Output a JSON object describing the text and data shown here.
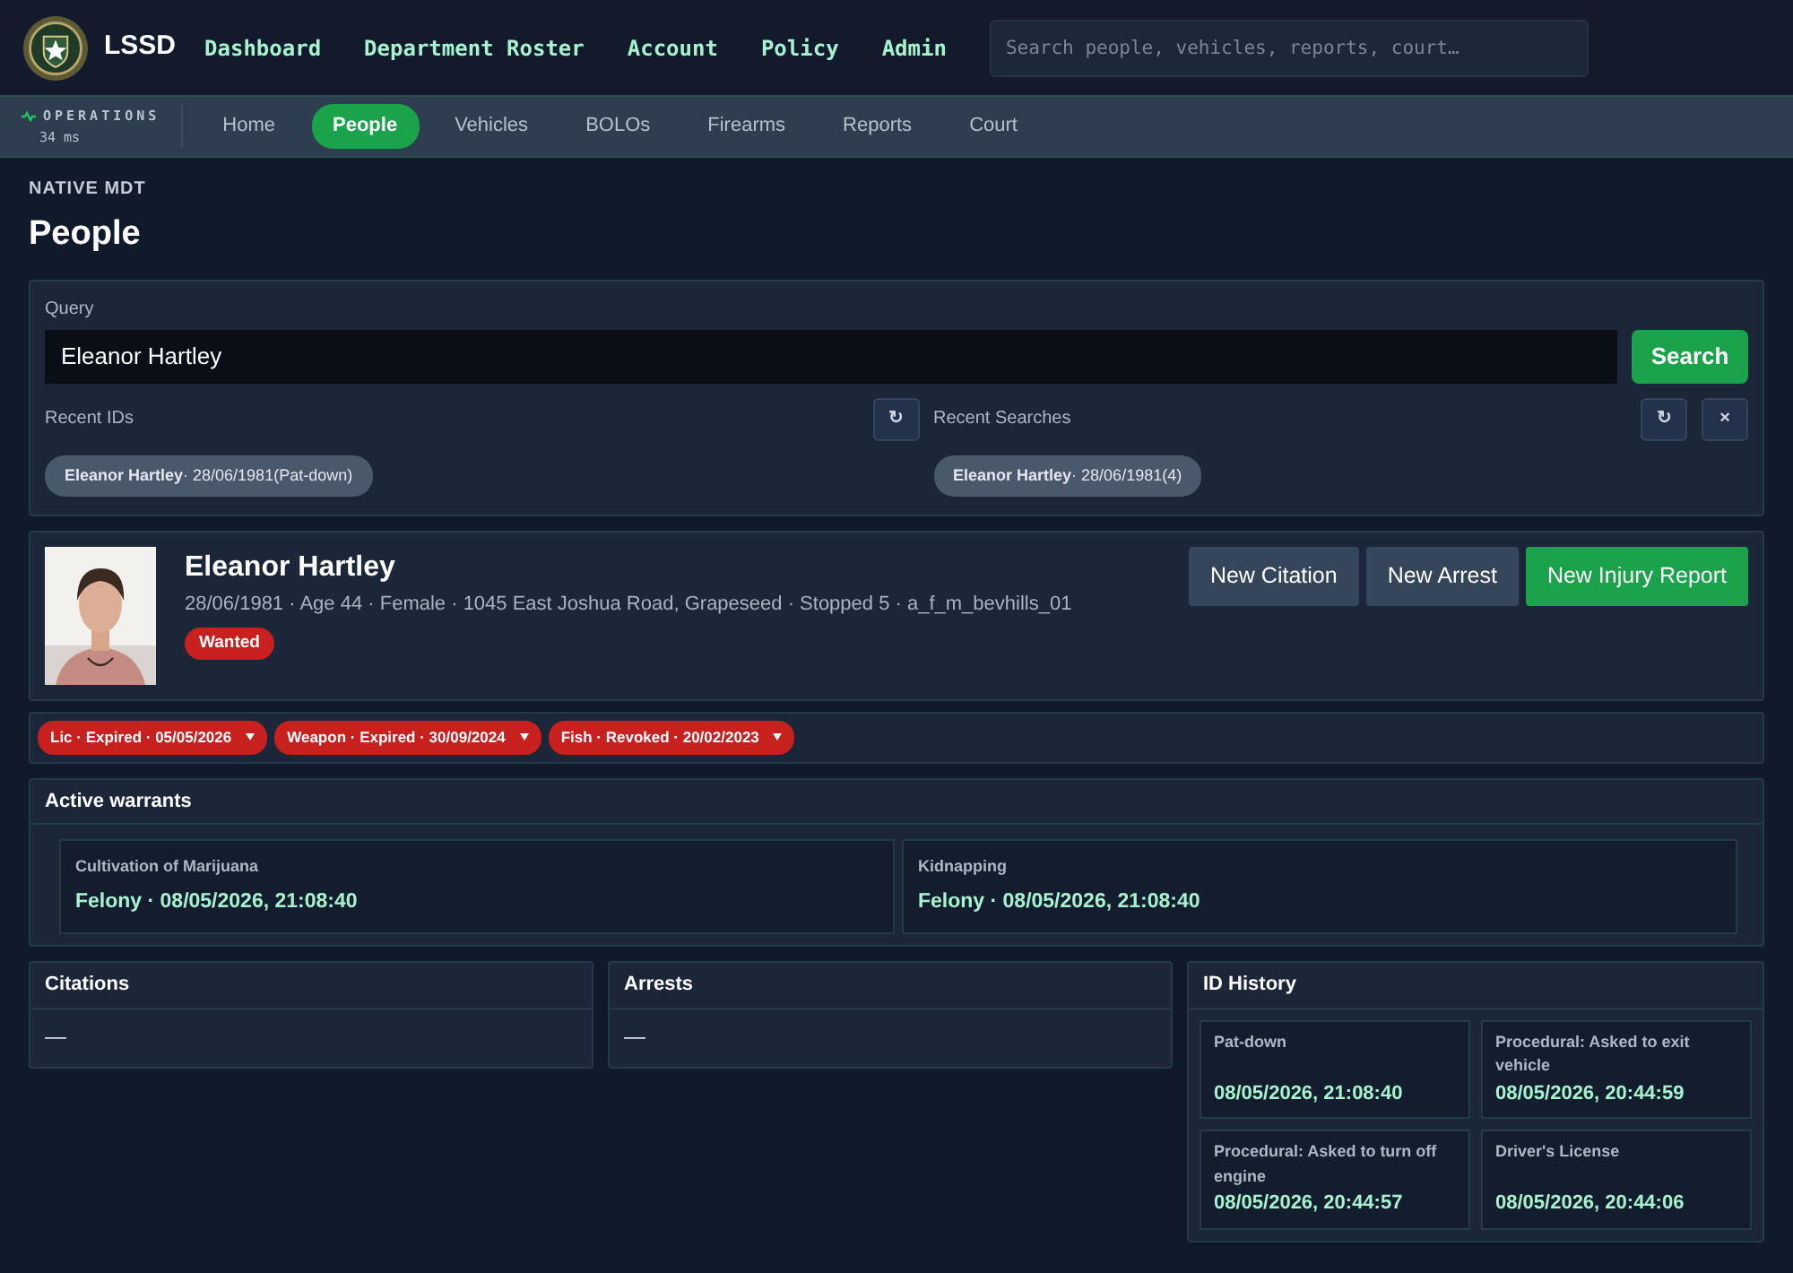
{
  "brand": {
    "name": "LSSD"
  },
  "top_nav": [
    {
      "label": "Dashboard"
    },
    {
      "label": "Department Roster"
    },
    {
      "label": "Account"
    },
    {
      "label": "Policy"
    },
    {
      "label": "Admin"
    }
  ],
  "global_search": {
    "placeholder": "Search people, vehicles, reports, court…"
  },
  "status": {
    "label": "OPERATIONS",
    "latency": "34 ms"
  },
  "tabs": [
    {
      "label": "Home",
      "selected": false
    },
    {
      "label": "People",
      "selected": true
    },
    {
      "label": "Vehicles",
      "selected": false
    },
    {
      "label": "BOLOs",
      "selected": false
    },
    {
      "label": "Firearms",
      "selected": false
    },
    {
      "label": "Reports",
      "selected": false
    },
    {
      "label": "Court",
      "selected": false
    }
  ],
  "page": {
    "eyebrow": "NATIVE MDT",
    "title": "People"
  },
  "query": {
    "label": "Query",
    "value": "Eleanor Hartley",
    "button": "Search",
    "recent_ids": {
      "label": "Recent IDs",
      "buttons": [
        "↻"
      ],
      "chips": [
        "**Eleanor Hartley**· 28/06/1981(Pat-down)"
      ]
    },
    "recent_searches": {
      "label": "Recent Searches",
      "buttons": [
        "↻",
        "×"
      ],
      "chips": [
        "**Eleanor Hartley**· 28/06/1981(4)"
      ]
    }
  },
  "profile": {
    "photo": {
      "kind": "picture"
    },
    "name": "Eleanor Hartley",
    "details": "28/06/1981 · Age 44 · Female · 1045 East Joshua Road, Grapeseed · Stopped 5 · a_f_m_bevhills_01",
    "badges": [
      "Wanted"
    ],
    "actions": [
      {
        "label": "New Citation",
        "kind": "secondary"
      },
      {
        "label": "New Arrest",
        "kind": "secondary"
      },
      {
        "label": "New Injury Report",
        "kind": "primary"
      }
    ]
  },
  "licenses": [
    {
      "label": "Lic · Expired · 05/05/2026"
    },
    {
      "label": "Weapon · Expired · 30/09/2024"
    },
    {
      "label": "Fish · Revoked · 20/02/2023"
    }
  ],
  "warrants": {
    "title": "Active warrants",
    "items": [
      {
        "charge": "Cultivation of Marijuana",
        "detail": "Felony · 08/05/2026, 21:08:40"
      },
      {
        "charge": "Kidnapping",
        "detail": "Felony · 08/05/2026, 21:08:40"
      }
    ]
  },
  "citations": {
    "title": "Citations",
    "empty": "—"
  },
  "arrests": {
    "title": "Arrests",
    "empty": "—"
  },
  "id_history": {
    "title": "ID History",
    "items": [
      {
        "reason": "Pat-down",
        "time": "08/05/2026, 21:08:40"
      },
      {
        "reason": "Procedural: Asked to exit vehicle",
        "time": "08/05/2026, 20:44:59"
      },
      {
        "reason": "Procedural: Asked to turn off engine",
        "time": "08/05/2026, 20:44:57"
      },
      {
        "reason": "Driver's License",
        "time": "08/05/2026, 20:44:06"
      }
    ]
  }
}
